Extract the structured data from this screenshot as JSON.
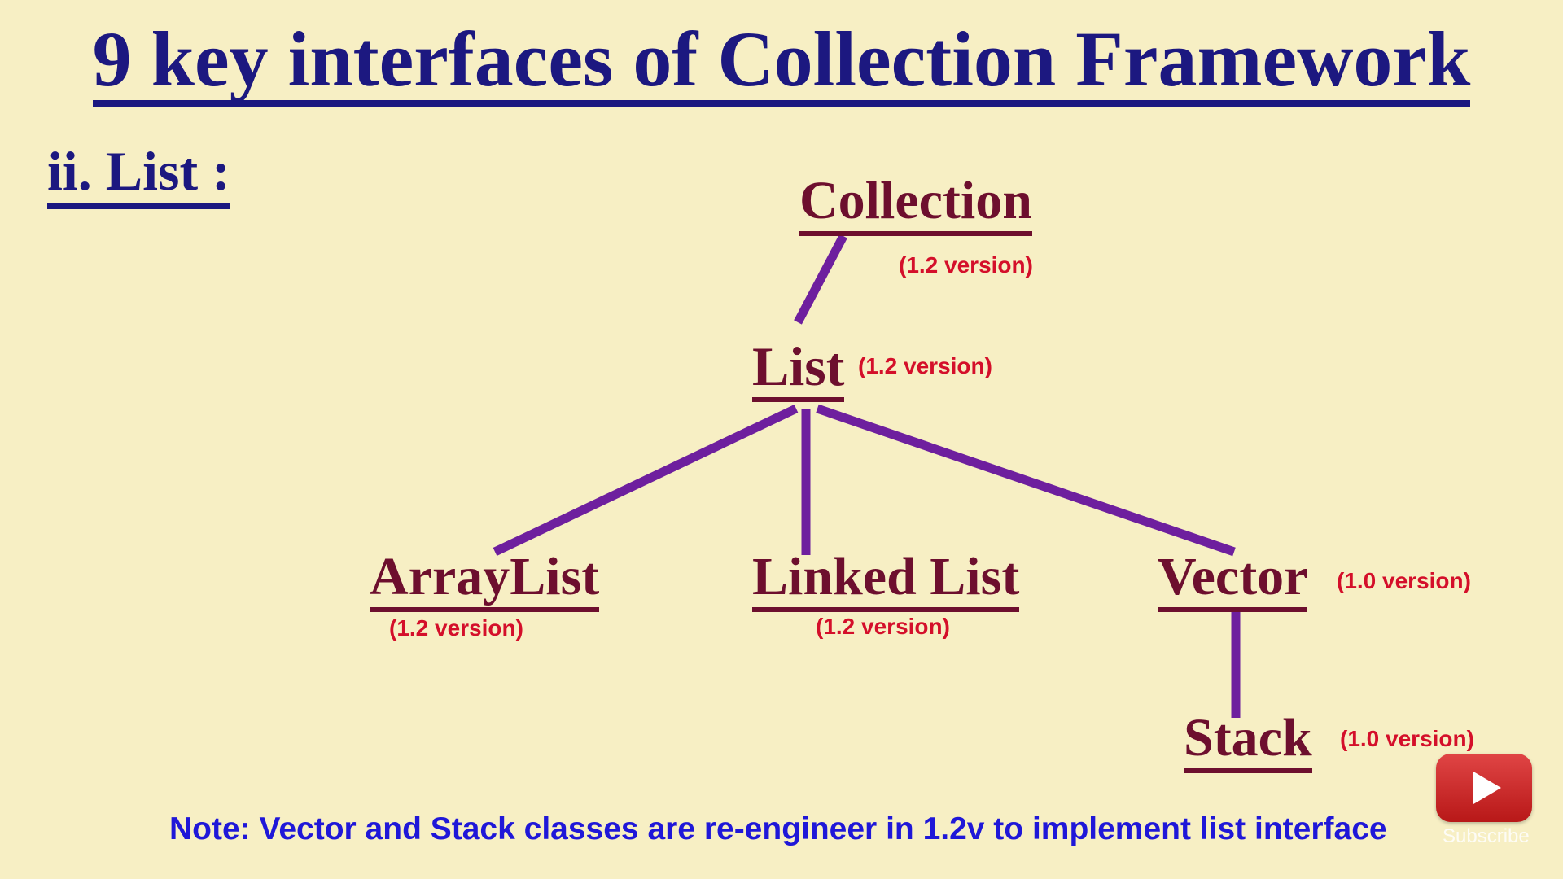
{
  "title": "9 key interfaces of Collection Framework",
  "section_heading": "ii. List :",
  "nodes": {
    "collection": {
      "label": "Collection",
      "version": "(1.2 version)"
    },
    "list": {
      "label": "List",
      "version": "(1.2 version)"
    },
    "arraylist": {
      "label": "ArrayList",
      "version": "(1.2 version)"
    },
    "linkedlist": {
      "label": "Linked List",
      "version": "(1.2 version)"
    },
    "vector": {
      "label": "Vector",
      "version": "(1.0 version)"
    },
    "stack": {
      "label": "Stack",
      "version": "(1.0 version)"
    }
  },
  "edges": [
    [
      "collection",
      "list"
    ],
    [
      "list",
      "arraylist"
    ],
    [
      "list",
      "linkedlist"
    ],
    [
      "list",
      "vector"
    ],
    [
      "vector",
      "stack"
    ]
  ],
  "note": "Note: Vector and Stack classes are re-engineer in 1.2v to implement list interface",
  "youtube": {
    "label": "Subscribe",
    "icon": "play-icon"
  },
  "colors": {
    "background": "#f7efc4",
    "title": "#1c1880",
    "node_text": "#6d0f2e",
    "version_text": "#d40f2a",
    "edge": "#6e1f9e",
    "note_text": "#1f17d8"
  }
}
